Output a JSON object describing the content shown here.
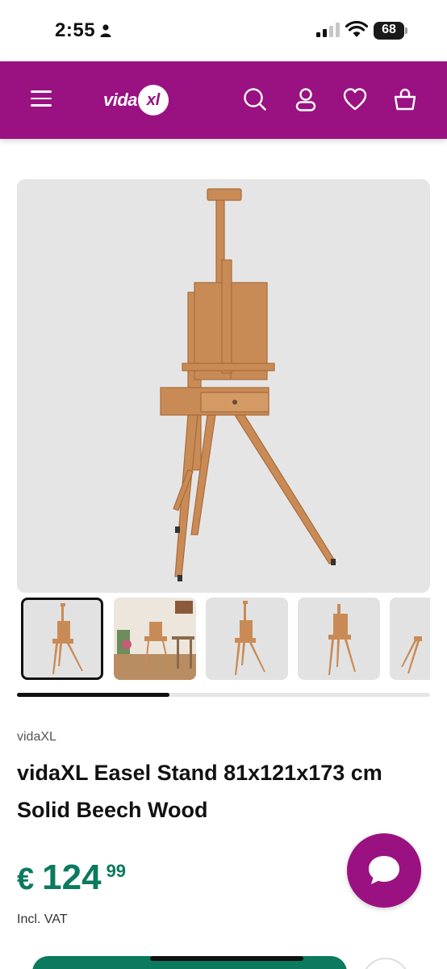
{
  "status_bar": {
    "time": "2:55",
    "battery": "68"
  },
  "header": {
    "logo_text": "vida",
    "logo_badge": "xl",
    "icons": [
      "menu-icon",
      "search-icon",
      "account-icon",
      "heart-icon",
      "basket-icon"
    ]
  },
  "gallery": {
    "thumbnail_count": 5,
    "selected_index": 0,
    "scroll_position": 0.37
  },
  "product": {
    "brand": "vidaXL",
    "title": "vidaXL Easel Stand 81x121x173 cm Solid Beech Wood",
    "price_currency": "€",
    "price_main": "124",
    "price_cents": "99",
    "vat_note": "Incl. VAT"
  },
  "colors": {
    "brand_purple": "#9a1282",
    "price_green": "#0b7a5e",
    "image_bg": "#e5e5e5",
    "wood": "#c98b56"
  }
}
